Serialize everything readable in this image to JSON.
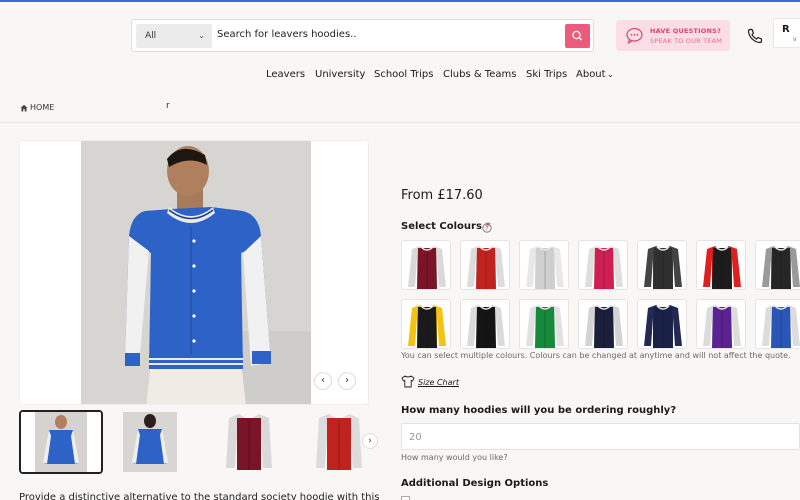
{
  "header": {
    "search": {
      "category": "All",
      "placeholder": "Search for leavers hoodies.."
    },
    "help": {
      "line1": "HAVE QUESTIONS?",
      "line2": "SPEAK TO OUR TEAM"
    },
    "account": {
      "initial": "R",
      "sub": "v"
    }
  },
  "nav": [
    "Leavers",
    "University",
    "School Trips",
    "Clubs & Teams",
    "Ski Trips",
    "About"
  ],
  "breadcrumb": {
    "home": "HOME",
    "rest": "r"
  },
  "product": {
    "price": "From £17.60",
    "select_colours": "Select Colours",
    "required_mark": "*",
    "colour_note": "You can select multiple colours. Colours can be changed at anytime and will not affect the quote.",
    "size_chart": "Size Chart",
    "quantity_question": "How many hoodies will you be ordering roughly?",
    "quantity_value": "20",
    "quantity_hint": "How many would you like?",
    "additional_options": "Additional Design Options",
    "description_start": "Provide a distinctive alternative to the standard society hoodie with this"
  },
  "swatches": [
    {
      "body": "#7a1527",
      "sleeve": "#d9d9d9"
    },
    {
      "body": "#c0231f",
      "sleeve": "#dcdcdc"
    },
    {
      "body": "#cfcfcf",
      "sleeve": "#e8e8e8"
    },
    {
      "body": "#cf1e54",
      "sleeve": "#dedede"
    },
    {
      "body": "#2f2f2f",
      "sleeve": "#444444"
    },
    {
      "body": "#1c1c1c",
      "sleeve": "#e01f1f"
    },
    {
      "body": "#262626",
      "sleeve": "#9a9a9a"
    },
    {
      "body": "#1a1a1a",
      "sleeve": "#f2c214"
    },
    {
      "body": "#141414",
      "sleeve": "#dadada"
    },
    {
      "body": "#17893a",
      "sleeve": "#e1e1e1"
    },
    {
      "body": "#1b1f3c",
      "sleeve": "#d3d3d3"
    },
    {
      "body": "#1a2147",
      "sleeve": "#222a52"
    },
    {
      "body": "#5a2391",
      "sleeve": "#dcdcdc"
    },
    {
      "body": "#2a56b8",
      "sleeve": "#dcdcdc"
    }
  ],
  "thumbs": [
    {
      "kind": "model-front",
      "body": "#2d62c7",
      "sleeve": "#f2f2f2"
    },
    {
      "kind": "model-back",
      "body": "#2d62c7",
      "sleeve": "#f2f2f2"
    },
    {
      "kind": "jacket",
      "body": "#7a1527",
      "sleeve": "#d9d9d9"
    },
    {
      "kind": "jacket",
      "body": "#c0231f",
      "sleeve": "#dcdcdc"
    }
  ],
  "colors": {
    "accent": "#ec5b7b",
    "help_bg": "#fbdde5",
    "topline": "#2f6fd8"
  }
}
